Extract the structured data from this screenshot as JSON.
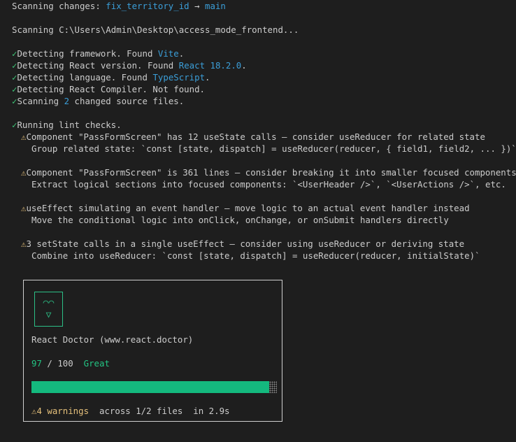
{
  "header": {
    "scanning_prefix": "Scanning changes: ",
    "branch_from": "fix_territory_id",
    "arrow": " → ",
    "branch_to": "main",
    "scanning_path": "Scanning C:\\Users\\Admin\\Desktop\\access_mode_frontend..."
  },
  "checks": [
    {
      "mark": "✓",
      "text": "Detecting framework. Found ",
      "value": "Vite",
      "suffix": "."
    },
    {
      "mark": "✓",
      "text": "Detecting React version. Found ",
      "value": "React 18.2.0",
      "suffix": "."
    },
    {
      "mark": "✓",
      "text": "Detecting language. Found ",
      "value": "TypeScript",
      "suffix": "."
    },
    {
      "mark": "✓",
      "text": "Detecting React Compiler. Not found.",
      "value": "",
      "suffix": ""
    },
    {
      "mark": "✓",
      "text": "Scanning ",
      "value": "2",
      "suffix": " changed source files."
    }
  ],
  "lint": {
    "mark": "✓",
    "title": "Running lint checks.",
    "warnings": [
      {
        "icon": "⚠",
        "message": "Component \"PassFormScreen\" has 12 useState calls — consider useReducer for related state",
        "hint": "Group related state: `const [state, dispatch] = useReducer(reducer, { field1, field2, ... })`"
      },
      {
        "icon": "⚠",
        "message": "Component \"PassFormScreen\" is 361 lines — consider breaking it into smaller focused components",
        "hint": "Extract logical sections into focused components: `<UserHeader />`, `<UserActions />`, etc."
      },
      {
        "icon": "⚠",
        "message": "useEffect simulating an event handler — move logic to an actual event handler instead",
        "hint": "Move the conditional logic into onClick, onChange, or onSubmit handlers directly"
      },
      {
        "icon": "⚠",
        "message": "3 setState calls in a single useEffect — consider using useReducer or deriving state",
        "hint": "Combine into useReducer: `const [state, dispatch] = useReducer(reducer, initialState)`"
      }
    ]
  },
  "card": {
    "face_eyes": "◠◠",
    "face_mouth": "▽",
    "title": "React Doctor (www.react.doctor)",
    "score": "97",
    "score_sep": " / ",
    "score_max": "100",
    "rating": "Great",
    "progress_fraction": 0.97,
    "warn_icon": "⚠",
    "warnings_label": "4 warnings",
    "files_label": "across 1/2 files",
    "time_label": "in 2.9s"
  },
  "colors": {
    "background": "#1e1e1e",
    "text": "#cccccc",
    "accent_blue": "#3b9ed8",
    "check_green": "#3fc97a",
    "warning_yellow": "#e5c07b",
    "score_green": "#23c483",
    "bar_green": "#14b97e"
  }
}
